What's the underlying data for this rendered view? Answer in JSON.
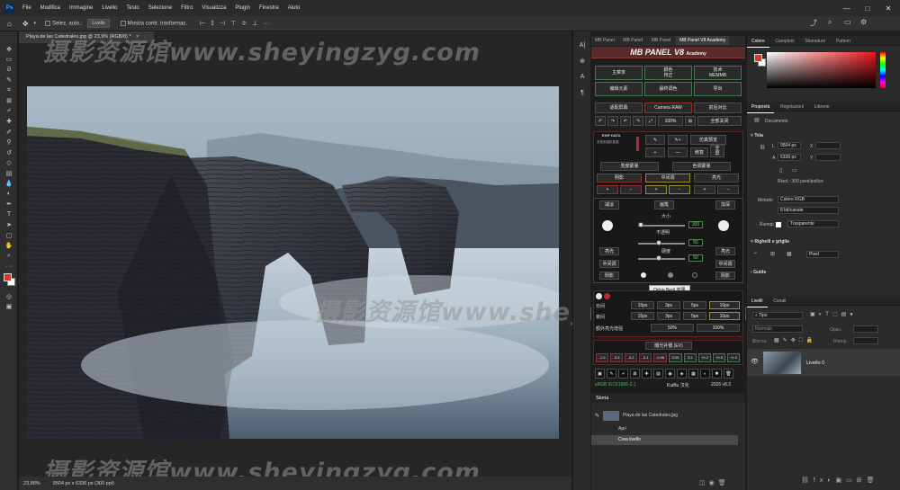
{
  "menu": {
    "logo": "Ps",
    "items": [
      "File",
      "Modifica",
      "Immagine",
      "Livello",
      "Testo",
      "Selezione",
      "Filtro",
      "Visualizza",
      "Plugin",
      "Finestra",
      "Aiuto"
    ],
    "win_min": "—",
    "win_max": "□",
    "win_close": "✕"
  },
  "options": {
    "auto_select_label": "Selez. auto.:",
    "auto_select_value": "Livello",
    "show_transform_label": "Mostra contr. trasformaz."
  },
  "document": {
    "tab_title": "Playa de las Catedrales.jpg @ 23,9% (RGB/8) *",
    "tab_close": "×",
    "zoom": "23,88%",
    "dimensions": "9504 px x 6336 px (300 ppi)"
  },
  "watermark": {
    "top": "摄影资源馆www.sheyingzyg.com",
    "mid": "摄影资源馆www.sheyingzyg.com",
    "bottom": "摄影资源馆www.sheyingzyg.com"
  },
  "mbpanel": {
    "tabs": [
      "MB Panel",
      "MB Panel",
      "MB Panel",
      "MB Panel V8 Academy"
    ],
    "title": "MB PANEL V8",
    "subtitle": "Academy",
    "btn_main": "主菜单",
    "btn_color": "颜色\n校正",
    "btn_tech": "技术\nMEMMB",
    "btn_edit": "编辑元素",
    "btn_final": "最终调色",
    "btn_export": "导出",
    "btn_adapt": "适配屏幕",
    "btn_camera": "Camera RAW",
    "btn_compare": "前后对比",
    "zoom_100": "100%",
    "btn_close_all": "全部关闭",
    "exif_data": "EXIF DATA",
    "exif_detail": "未找到相机数据",
    "btn_preview": "仿真预览",
    "btn_heal": "修复",
    "btn_full": "全\n屏",
    "btn_luminosity": "亮度蒙版",
    "btn_color_range": "色调蒙版",
    "shadows": "阴影",
    "midtones": "中间调",
    "highlights": "亮光",
    "dodge": "减淡",
    "burn": "加深",
    "size": "大小",
    "opacity": "不透明",
    "hardness": "硬度",
    "size_val": "300",
    "opacity_val": "50",
    "hardness_val": "50",
    "tooltip": "Orton Berti 效果",
    "sun": "日间",
    "night": "夜间",
    "px15": "15px",
    "px3": "3px",
    "px5": "5px",
    "px10": "10px",
    "glow": "额外亮光增强",
    "p50": "50%",
    "p100": "100%",
    "ev_title": "曝光补偿 (EV)",
    "ev_values": [
      "-1.0",
      "-0.5",
      "-0.2",
      "-0.1",
      "-0.05",
      "0.05",
      "0.1",
      "+0.2",
      "+0.5",
      "+1.0"
    ],
    "srgb": "sRGB IEC61966-2.1",
    "author": "KuiBu 汉化",
    "version": "2026 v8.3"
  },
  "storia": {
    "title": "Storia",
    "file": "Playa de las Catedrales.jpg",
    "steps": [
      "Apri",
      "Crea livello"
    ]
  },
  "color_panel": {
    "tabs": [
      "Colore",
      "Campioni",
      "Sfumature",
      "Pattern"
    ],
    "fg_color": "#e8311b",
    "bg_color": "#ffffff",
    "spectrum": "#e8151b"
  },
  "properties": {
    "tabs": [
      "Proprietà",
      "Regolazioni",
      "Librerie"
    ],
    "doc_label": "Documento",
    "canvas": "Tela",
    "l_label": "L",
    "l_value": "9504 px",
    "a_label": "A",
    "a_value": "6336 px",
    "x_label": "X",
    "y_label": "Y",
    "res": "Risol.: 300 pixel/pollice",
    "method_label": "Metodo",
    "method_value": "Colore RGB",
    "bit_value": "8 bit/canale",
    "fill_label": "Riempi",
    "fill_value": "Trasparente",
    "rulers": "Righelli e griglie",
    "units": "Pixel",
    "guides": "Guide"
  },
  "layers": {
    "tabs": [
      "Livelli",
      "Canali"
    ],
    "kind": "Tipo",
    "blend": "Normale",
    "opacity_label": "Opac.:",
    "lock_label": "Blocca:",
    "fill_label": "Riemp.:",
    "layer_name": "Livello 0"
  }
}
